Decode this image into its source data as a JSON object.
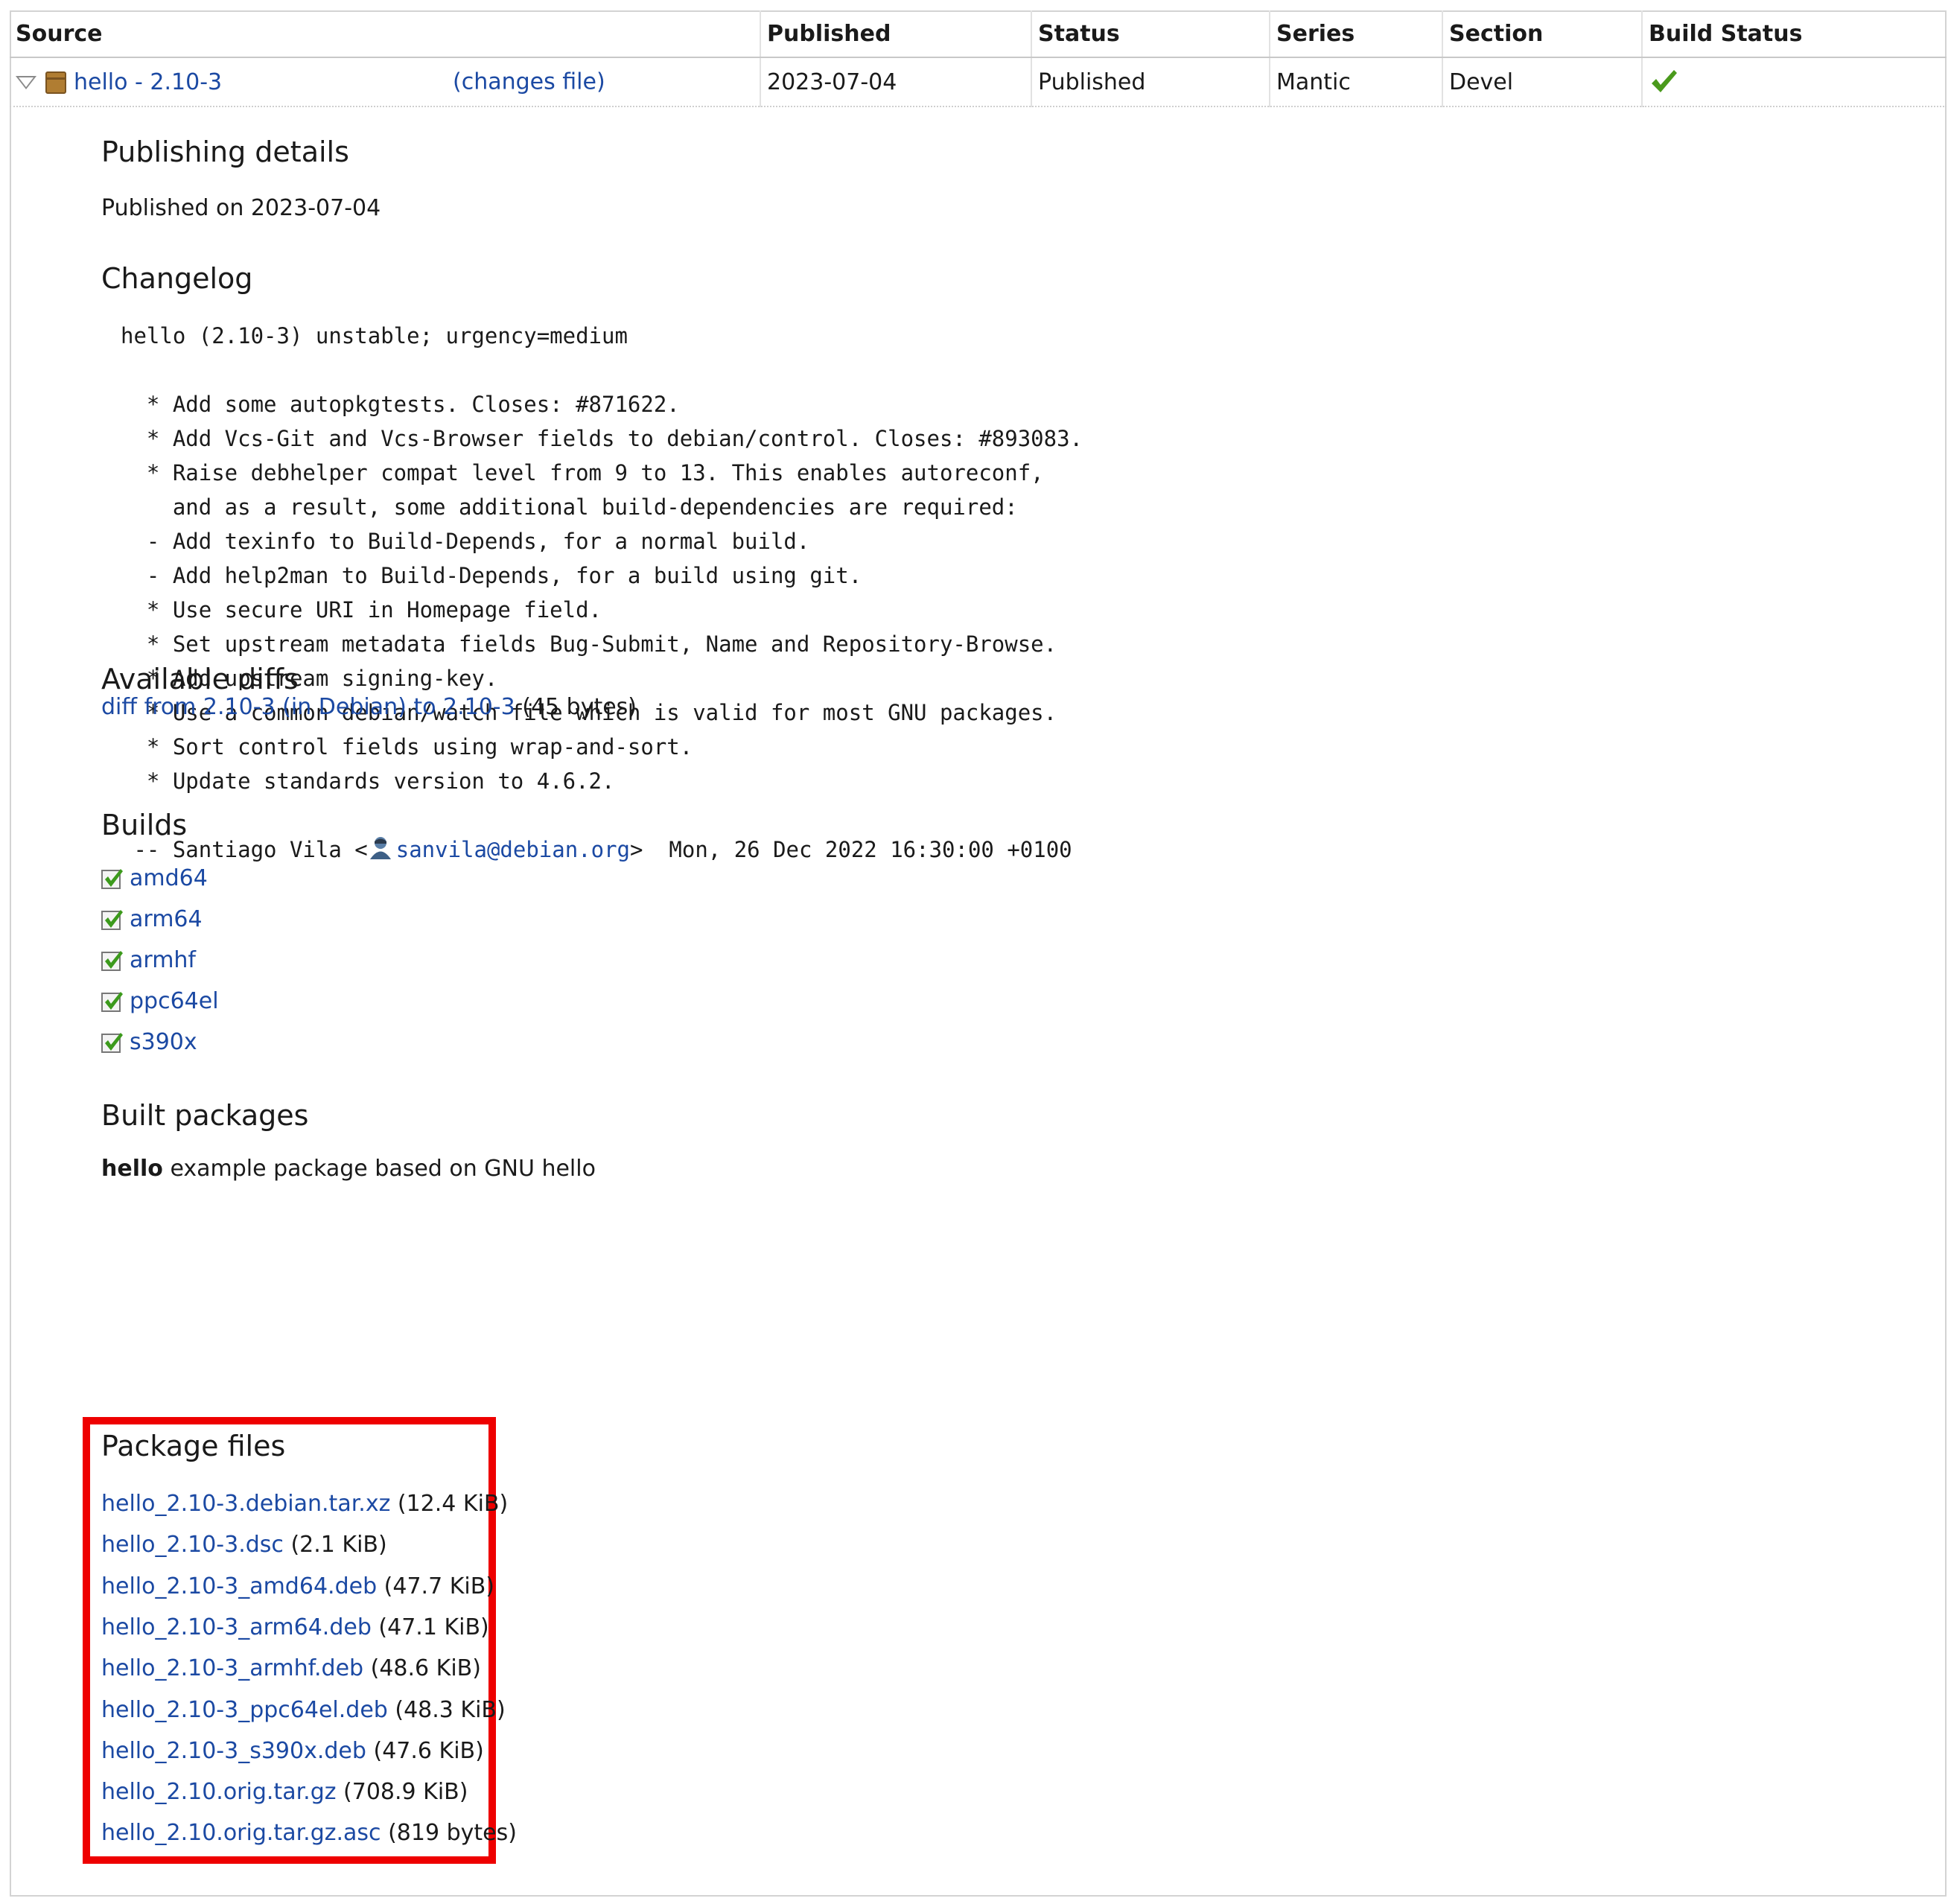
{
  "table": {
    "headers": {
      "source": "Source",
      "published": "Published",
      "status": "Status",
      "series": "Series",
      "section": "Section",
      "build_status": "Build Status"
    },
    "row": {
      "source_link": "hello - 2.10-3",
      "changes_link": "(changes file)",
      "published": "2023-07-04",
      "status": "Published",
      "series": "Mantic",
      "section": "Devel",
      "build_status_icon": "green-checkmark-icon"
    }
  },
  "publishing": {
    "heading": "Publishing details",
    "text": "Published on 2023-07-04"
  },
  "changelog": {
    "heading": "Changelog",
    "lines": [
      "hello (2.10-3) unstable; urgency=medium",
      "",
      "  * Add some autopkgtests. Closes: #871622.",
      "  * Add Vcs-Git and Vcs-Browser fields to debian/control. Closes: #893083.",
      "  * Raise debhelper compat level from 9 to 13. This enables autoreconf,",
      "    and as a result, some additional build-dependencies are required:",
      "  - Add texinfo to Build-Depends, for a normal build.",
      "  - Add help2man to Build-Depends, for a build using git.",
      "  * Use secure URI in Homepage field.",
      "  * Set upstream metadata fields Bug-Submit, Name and Repository-Browse.",
      "  * Add upstream signing-key.",
      "  * Use a common debian/watch file which is valid for most GNU packages.",
      "  * Sort control fields using wrap-and-sort.",
      "  * Update standards version to 4.6.2.",
      ""
    ],
    "signoff_prefix": " -- Santiago Vila <",
    "signoff_email": "sanvila@debian.org",
    "signoff_suffix": ">  Mon, 26 Dec 2022 16:30:00 +0100"
  },
  "diffs": {
    "heading": "Available diffs",
    "link": "diff from 2.10-3 (in Debian) to 2.10-3",
    "size": "(45 bytes)"
  },
  "builds": {
    "heading": "Builds",
    "items": [
      "amd64",
      "arm64",
      "armhf",
      "ppc64el",
      "s390x"
    ]
  },
  "built_packages": {
    "heading": "Built packages",
    "name": "hello",
    "description": "example package based on GNU hello"
  },
  "package_files": {
    "heading": "Package files",
    "items": [
      {
        "name": "hello_2.10-3.debian.tar.xz",
        "size": "(12.4 KiB)"
      },
      {
        "name": "hello_2.10-3.dsc",
        "size": "(2.1 KiB)"
      },
      {
        "name": "hello_2.10-3_amd64.deb",
        "size": "(47.7 KiB)"
      },
      {
        "name": "hello_2.10-3_arm64.deb",
        "size": "(47.1 KiB)"
      },
      {
        "name": "hello_2.10-3_armhf.deb",
        "size": "(48.6 KiB)"
      },
      {
        "name": "hello_2.10-3_ppc64el.deb",
        "size": "(48.3 KiB)"
      },
      {
        "name": "hello_2.10-3_s390x.deb",
        "size": "(47.6 KiB)"
      },
      {
        "name": "hello_2.10.orig.tar.gz",
        "size": "(708.9 KiB)"
      },
      {
        "name": "hello_2.10.orig.tar.gz.asc",
        "size": "(819 bytes)"
      }
    ]
  },
  "colors": {
    "link": "#1b49a3",
    "highlight": "#ee0000",
    "check": "#4a9a1c"
  }
}
